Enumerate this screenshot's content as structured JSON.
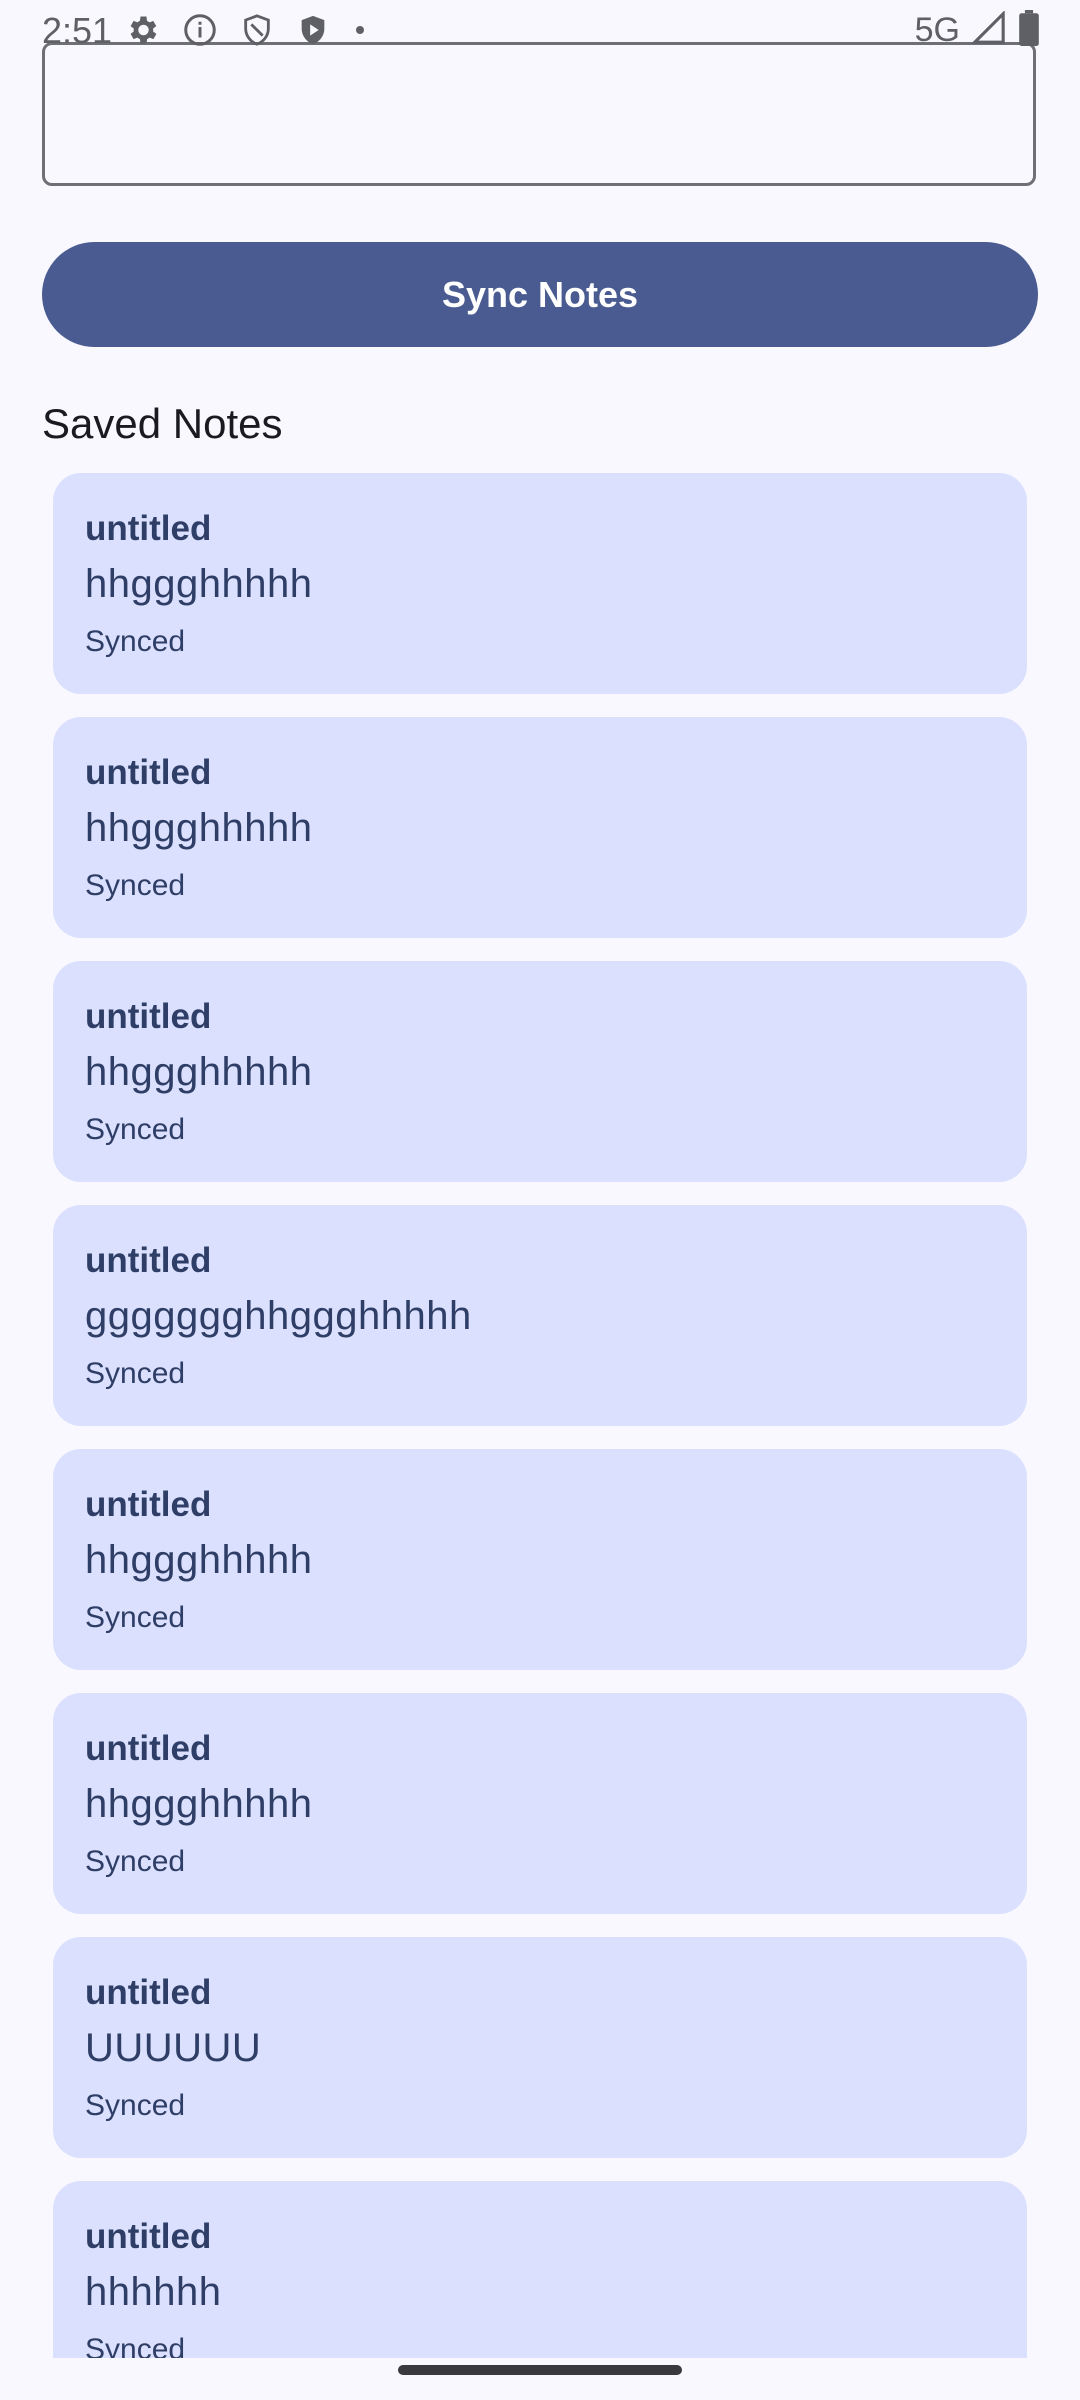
{
  "status_bar": {
    "time": "2:51",
    "network": "5G",
    "icons_left": [
      "settings-icon",
      "info-icon",
      "shield-outline-icon",
      "shield-play-icon",
      "dot-icon"
    ],
    "icons_right": [
      "signal-icon",
      "battery-icon"
    ]
  },
  "note_input": {
    "value": "",
    "placeholder": ""
  },
  "sync_button": {
    "label": "Sync Notes"
  },
  "saved_notes": {
    "title": "Saved Notes",
    "items": [
      {
        "title": "untitled",
        "body": "hhggghhhhh",
        "status": "Synced"
      },
      {
        "title": "untitled",
        "body": "hhggghhhhh",
        "status": "Synced"
      },
      {
        "title": "untitled",
        "body": "hhggghhhhh",
        "status": "Synced"
      },
      {
        "title": "untitled",
        "body": "ggggggghhggghhhhh",
        "status": "Synced"
      },
      {
        "title": "untitled",
        "body": "hhggghhhhh",
        "status": "Synced"
      },
      {
        "title": "untitled",
        "body": "hhggghhhhh",
        "status": "Synced"
      },
      {
        "title": "untitled",
        "body": "UUUUUU",
        "status": "Synced"
      },
      {
        "title": "untitled",
        "body": "hhhhhh",
        "status": "Synced"
      }
    ]
  },
  "colors": {
    "background": "#F9F8FE",
    "primary": "#4A5B91",
    "card": "#DAE0FD",
    "card_text": "#2F3E66"
  }
}
